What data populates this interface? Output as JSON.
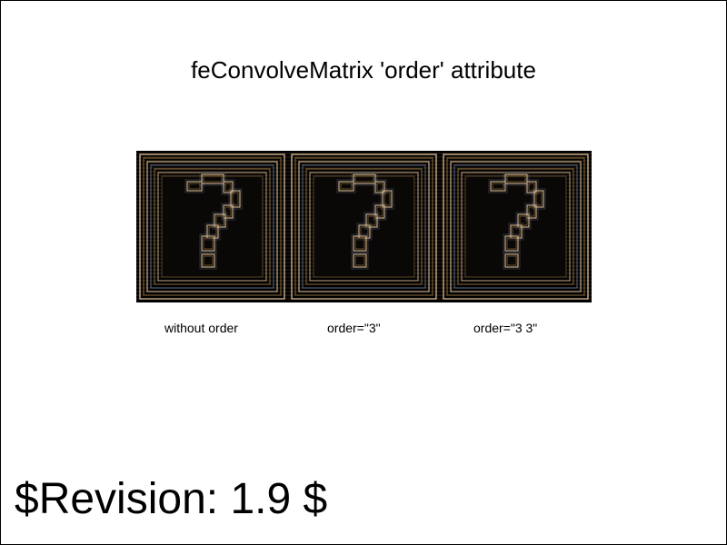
{
  "title": "feConvolveMatrix 'order' attribute",
  "panels": [
    {
      "caption": "without order"
    },
    {
      "caption": "order=\"3\""
    },
    {
      "caption": "order=\"3 3\""
    }
  ],
  "footer": {
    "revision": "$Revision: 1.9 $"
  },
  "colors": {
    "panel_background": "#000000",
    "edge_light": "#e8c9a0",
    "edge_mid": "#8a6a3a",
    "edge_cool": "#6f7fa0"
  },
  "icons": {
    "panel_image": "question-mark-block-icon"
  }
}
